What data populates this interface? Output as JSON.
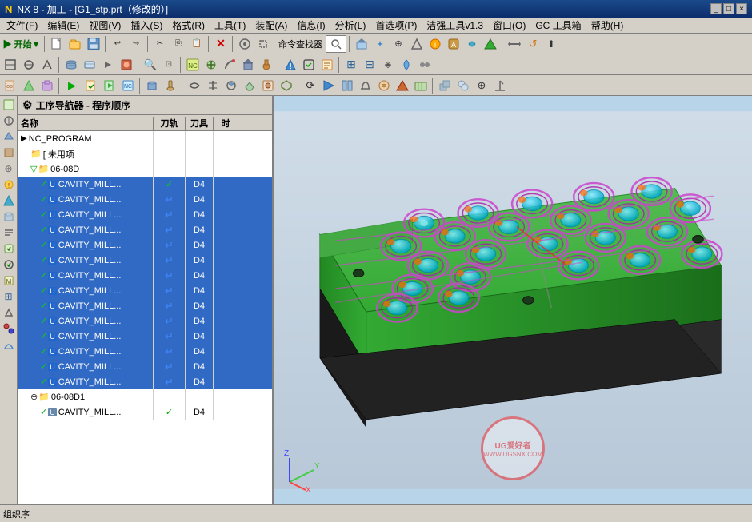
{
  "titlebar": {
    "icon": "NX",
    "title": "NX 8 - 加工 - [G1_stp.prt（修改的）]"
  },
  "menubar": {
    "items": [
      {
        "label": "文件(F)",
        "id": "file"
      },
      {
        "label": "编辑(E)",
        "id": "edit"
      },
      {
        "label": "视图(V)",
        "id": "view"
      },
      {
        "label": "插入(S)",
        "id": "insert"
      },
      {
        "label": "格式(R)",
        "id": "format"
      },
      {
        "label": "工具(T)",
        "id": "tools"
      },
      {
        "label": "装配(A)",
        "id": "assembly"
      },
      {
        "label": "信息(I)",
        "id": "info"
      },
      {
        "label": "分析(L)",
        "id": "analysis"
      },
      {
        "label": "首选项(P)",
        "id": "preferences"
      },
      {
        "label": "洁强工具v1.3",
        "id": "jiehtools"
      },
      {
        "label": "窗口(O)",
        "id": "window"
      },
      {
        "label": "GC 工具箱",
        "id": "gctoolbox"
      },
      {
        "label": "帮助(H)",
        "id": "help"
      }
    ]
  },
  "navigator": {
    "title": "工序导航器 - 程序顺序",
    "columns": {
      "name": "名称",
      "tool_path": "刀轨",
      "cutter": "刀具",
      "time": "时"
    },
    "tree": [
      {
        "id": "nc_program",
        "label": "NC_PROGRAM",
        "level": 0,
        "type": "root",
        "check": "",
        "toolpath": "",
        "cutter": "",
        "time": ""
      },
      {
        "id": "unused",
        "label": "[ 未用项",
        "level": 1,
        "type": "folder",
        "check": "",
        "toolpath": "",
        "cutter": "",
        "time": ""
      },
      {
        "id": "06-08D",
        "label": "06-08D",
        "level": 1,
        "type": "folder-check",
        "check": "✓",
        "toolpath": "",
        "cutter": "",
        "time": ""
      },
      {
        "id": "row1",
        "label": "CAVITY_MILL...",
        "level": 2,
        "type": "op",
        "check": "✓",
        "toolpath": "✓",
        "cutter": "D4",
        "time": "",
        "selected": true
      },
      {
        "id": "row2",
        "label": "CAVITY_MILL...",
        "level": 2,
        "type": "op",
        "check": "✓",
        "toolpath": "↵",
        "cutter": "D4",
        "time": "",
        "selected": true
      },
      {
        "id": "row3",
        "label": "CAVITY_MILL...",
        "level": 2,
        "type": "op",
        "check": "✓",
        "toolpath": "↵",
        "cutter": "D4",
        "time": "",
        "selected": true
      },
      {
        "id": "row4",
        "label": "CAVITY_MILL...",
        "level": 2,
        "type": "op",
        "check": "✓",
        "toolpath": "↵",
        "cutter": "D4",
        "time": "",
        "selected": true
      },
      {
        "id": "row5",
        "label": "CAVITY_MILL...",
        "level": 2,
        "type": "op",
        "check": "✓",
        "toolpath": "↵",
        "cutter": "D4",
        "time": "",
        "selected": true
      },
      {
        "id": "row6",
        "label": "CAVITY_MILL...",
        "level": 2,
        "type": "op",
        "check": "✓",
        "toolpath": "↵",
        "cutter": "D4",
        "time": "",
        "selected": true
      },
      {
        "id": "row7",
        "label": "CAVITY_MILL...",
        "level": 2,
        "type": "op",
        "check": "✓",
        "toolpath": "↵",
        "cutter": "D4",
        "time": "",
        "selected": true
      },
      {
        "id": "row8",
        "label": "CAVITY_MILL...",
        "level": 2,
        "type": "op",
        "check": "✓",
        "toolpath": "↵",
        "cutter": "D4",
        "time": "",
        "selected": true
      },
      {
        "id": "row9",
        "label": "CAVITY_MILL...",
        "level": 2,
        "type": "op",
        "check": "✓",
        "toolpath": "↵",
        "cutter": "D4",
        "time": "",
        "selected": true
      },
      {
        "id": "row10",
        "label": "CAVITY_MILL...",
        "level": 2,
        "type": "op",
        "check": "✓",
        "toolpath": "↵",
        "cutter": "D4",
        "time": "",
        "selected": true
      },
      {
        "id": "row11",
        "label": "CAVITY_MILL...",
        "level": 2,
        "type": "op",
        "check": "✓",
        "toolpath": "↵",
        "cutter": "D4",
        "time": "",
        "selected": true
      },
      {
        "id": "row12",
        "label": "CAVITY_MILL...",
        "level": 2,
        "type": "op",
        "check": "✓",
        "toolpath": "↵",
        "cutter": "D4",
        "time": "",
        "selected": true
      },
      {
        "id": "row13",
        "label": "CAVITY_MILL...",
        "level": 2,
        "type": "op",
        "check": "✓",
        "toolpath": "↵",
        "cutter": "D4",
        "time": "",
        "selected": true
      },
      {
        "id": "row14",
        "label": "CAVITY_MILL...",
        "level": 2,
        "type": "op",
        "check": "✓",
        "toolpath": "↵",
        "cutter": "D4",
        "time": "",
        "selected": true
      },
      {
        "id": "06-08D1",
        "label": "06-08D1",
        "level": 1,
        "type": "folder-minus",
        "check": "−",
        "toolpath": "",
        "cutter": "",
        "time": ""
      },
      {
        "id": "row15",
        "label": "CAVITY_MILL...",
        "level": 2,
        "type": "op",
        "check": "✓",
        "toolpath": "✓",
        "cutter": "D4",
        "time": "",
        "selected": false
      }
    ]
  },
  "toolbar_cmd": {
    "search_label": "命令查找器"
  },
  "statusbar": {
    "text": "组织序"
  },
  "viewport": {
    "background_color": "#b8c8d8",
    "model_color": "#44aa44"
  },
  "axis": {
    "x_label": "X",
    "y_label": "Y",
    "z_label": "Z"
  },
  "watermark": {
    "site": "WWW.UGSNX.COM",
    "brand": "UG爱好者"
  }
}
